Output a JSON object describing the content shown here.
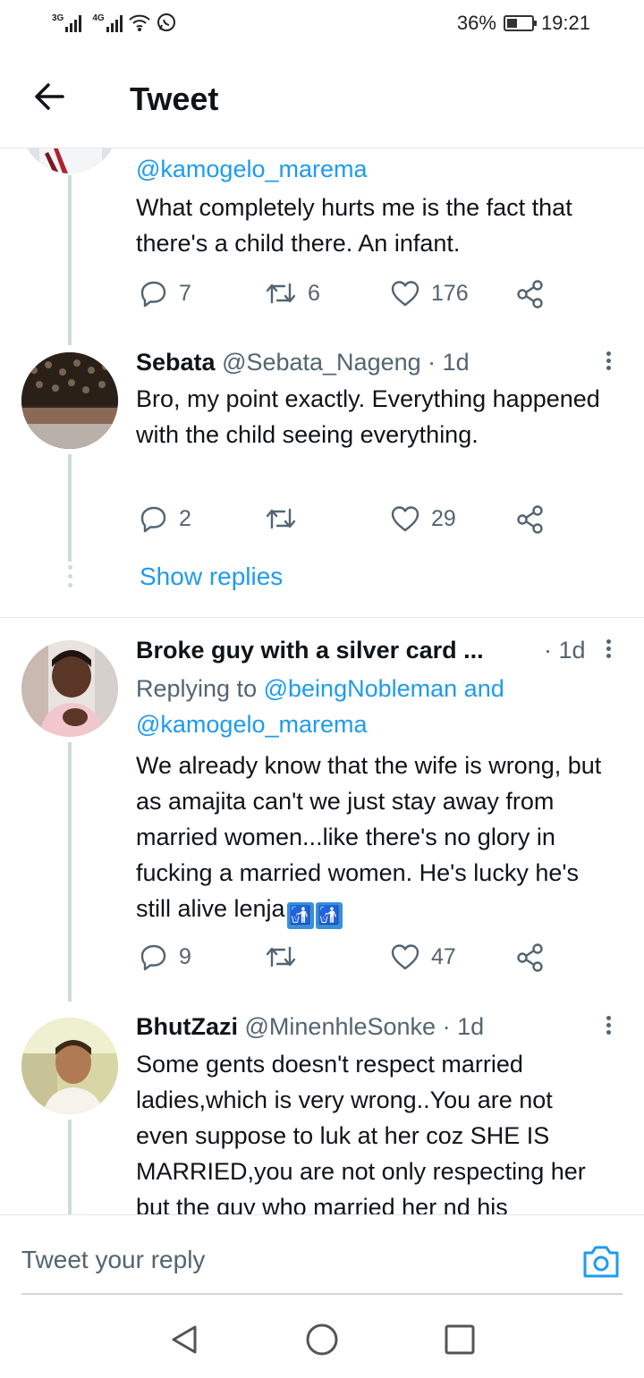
{
  "status_bar": {
    "network1": "3G",
    "network2": "4G",
    "battery": "36%",
    "time": "19:21"
  },
  "header": {
    "title": "Tweet"
  },
  "tweets": [
    {
      "handle": "@kamogelo_marema",
      "text": "What completely hurts me is the fact that there's a child there. An infant.",
      "replies": "7",
      "retweets": "6",
      "likes": "176"
    },
    {
      "name": "Sebata",
      "handle": "@Sebata_Nageng",
      "time": "· 1d",
      "text": "Bro, my point exactly. Everything happened with the child seeing everything.",
      "replies": "2",
      "retweets": "",
      "likes": "29"
    },
    {
      "name": "Broke guy with a silver card ...",
      "time": "· 1d",
      "replying_prefix": "Replying to",
      "replying_to_1": "@beingNobleman",
      "replying_and": "and",
      "replying_to_2": "@kamogelo_marema",
      "text": "We already know that the wife is wrong, but as amajita can't we just stay away from married women...like there's no glory in fucking a married women. He's lucky he's still alive lenja",
      "replies": "9",
      "retweets": "",
      "likes": "47"
    },
    {
      "name": "BhutZazi",
      "handle": "@MinenhleSonke",
      "time": "· 1d",
      "text": "Some gents doesn't respect married ladies,which is very wrong..You are not even suppose to luk at her coz SHE IS MARRIED,you are not only respecting her but the guy who married her nd his"
    }
  ],
  "show_replies": "Show replies",
  "composer": {
    "placeholder": "Tweet your reply"
  },
  "colors": {
    "accent": "#1d9bf0",
    "secondary_text": "#536471",
    "thread_line": "#cfd9de"
  },
  "icons": [
    "back-arrow-icon",
    "more-vertical-icon",
    "reply-icon",
    "retweet-icon",
    "like-icon",
    "share-icon",
    "camera-icon",
    "wastebasket-emoji"
  ]
}
